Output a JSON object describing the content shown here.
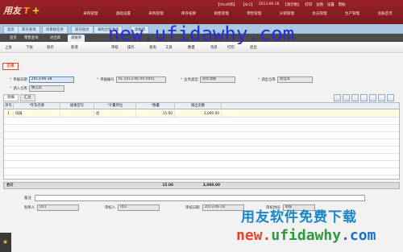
{
  "header": {
    "brand": "用友",
    "brand_mark": "T",
    "brand_suffix": "+",
    "info": [
      "【Vtsaft库】",
      "【dc1】",
      "2013-06-18",
      "【演示数】",
      "打印",
      "注销",
      "设置",
      "帮助"
    ],
    "modules": [
      "采购管理",
      "基础设置",
      "采购管理",
      "库存核算",
      "销售管理",
      "零售管理",
      "分销管理",
      "会员管理",
      "生产管理",
      "总账首页"
    ]
  },
  "tabs_row1": [
    "首页",
    "库存查询",
    "待审核任务",
    "库存盘点",
    "采购全部清单",
    "调拨单"
  ],
  "tabs_row2": [
    "首页",
    "零售查询",
    "进出库",
    "调拨单"
  ],
  "toolbar": {
    "items": [
      "上张",
      "下张",
      "保存",
      "新增",
      "审核",
      "操作",
      "查询",
      "工具",
      "数量",
      "消息",
      "打印",
      "退出"
    ]
  },
  "stamp": "已审",
  "form": {
    "date_label": "单据日期",
    "date_value": "2013-06-18",
    "billno_label": "单据编号",
    "billno_value": "AL-2013-06-00-0001",
    "biztype_label": "业务类型",
    "biztype_value": "同价调拨",
    "out_wh_label": "调出仓库",
    "out_wh_value": "宽电库",
    "in_wh_label": "调入仓库",
    "in_wh_value": "惠山库"
  },
  "grid_tabs": [
    "明细",
    "汇总"
  ],
  "grid": {
    "columns": [
      "序号",
      "存货名称",
      "规格型号",
      "计量单位",
      "数量",
      "调出金额"
    ],
    "rows": [
      {
        "no": "1",
        "name": "风扇",
        "spec": "",
        "unit": "台",
        "qty": "15.00",
        "amount": "3,000.00"
      }
    ]
  },
  "totals": {
    "label": "合计",
    "qty": "15.00",
    "amount": "3,000.00"
  },
  "footer": {
    "remark_label": "备注",
    "maker_label": "制单人",
    "maker_value": "001",
    "auditor_label": "审核人",
    "auditor_value": "001",
    "audit_date_label": "审核日期",
    "audit_date_value": "2013-06-18",
    "reviewer_label": "审核时间",
    "reviewer_value": "审核"
  },
  "watermark": {
    "url_top": "new.ufidawhy.com",
    "cn_text": "用友软件免费下载",
    "url_bottom": "new.ufidawhy.com"
  },
  "colors": {
    "header": "#9b2128",
    "watermark_blue": "#2a2ad8",
    "stamp": "#d34a2a"
  }
}
